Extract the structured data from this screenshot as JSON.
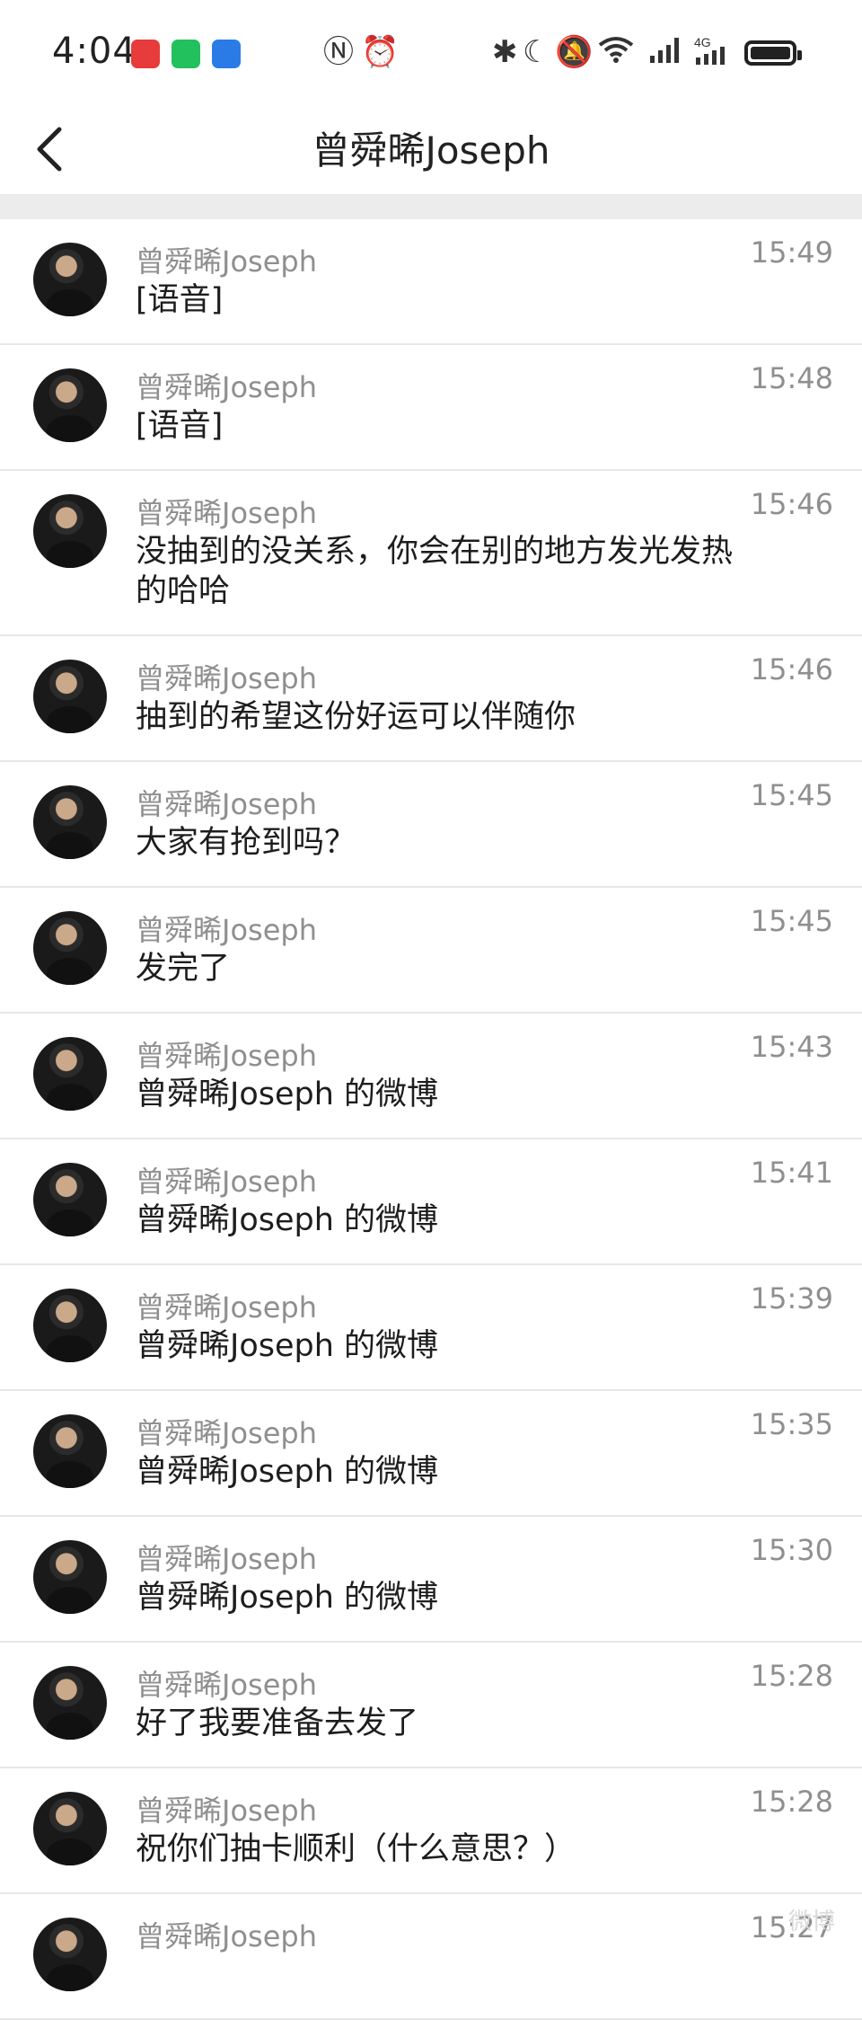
{
  "status_bar": {
    "time": "4:04",
    "chips": [
      "huawei-music-app",
      "wechat-app",
      "voice-memo-app"
    ],
    "icons": [
      "nfc-icon",
      "alarm-icon",
      "bluetooth-icon",
      "moon-icon",
      "mute-icon",
      "wifi-icon",
      "signal-icon",
      "4g-signal-icon",
      "battery-icon"
    ]
  },
  "nav": {
    "title": "曾舜晞Joseph",
    "back_icon": "chevron-left-icon"
  },
  "messages": [
    {
      "sender": "曾舜晞Joseph",
      "text": "[语音]",
      "time": "15:49"
    },
    {
      "sender": "曾舜晞Joseph",
      "text": "[语音]",
      "time": "15:48"
    },
    {
      "sender": "曾舜晞Joseph",
      "text": "没抽到的没关系，你会在别的地方发光发热的哈哈",
      "time": "15:46"
    },
    {
      "sender": "曾舜晞Joseph",
      "text": "抽到的希望这份好运可以伴随你",
      "time": "15:46"
    },
    {
      "sender": "曾舜晞Joseph",
      "text": "大家有抢到吗？",
      "time": "15:45"
    },
    {
      "sender": "曾舜晞Joseph",
      "text": "发完了",
      "time": "15:45"
    },
    {
      "sender": "曾舜晞Joseph",
      "text": "曾舜晞Joseph 的微博",
      "time": "15:43"
    },
    {
      "sender": "曾舜晞Joseph",
      "text": "曾舜晞Joseph 的微博",
      "time": "15:41"
    },
    {
      "sender": "曾舜晞Joseph",
      "text": "曾舜晞Joseph 的微博",
      "time": "15:39"
    },
    {
      "sender": "曾舜晞Joseph",
      "text": "曾舜晞Joseph 的微博",
      "time": "15:35"
    },
    {
      "sender": "曾舜晞Joseph",
      "text": "曾舜晞Joseph 的微博",
      "time": "15:30"
    },
    {
      "sender": "曾舜晞Joseph",
      "text": "好了我要准备去发了",
      "time": "15:28"
    },
    {
      "sender": "曾舜晞Joseph",
      "text": "祝你们抽卡顺利（什么意思？）",
      "time": "15:28"
    },
    {
      "sender": "曾舜晞Joseph",
      "text": "",
      "time": "15:27"
    }
  ]
}
